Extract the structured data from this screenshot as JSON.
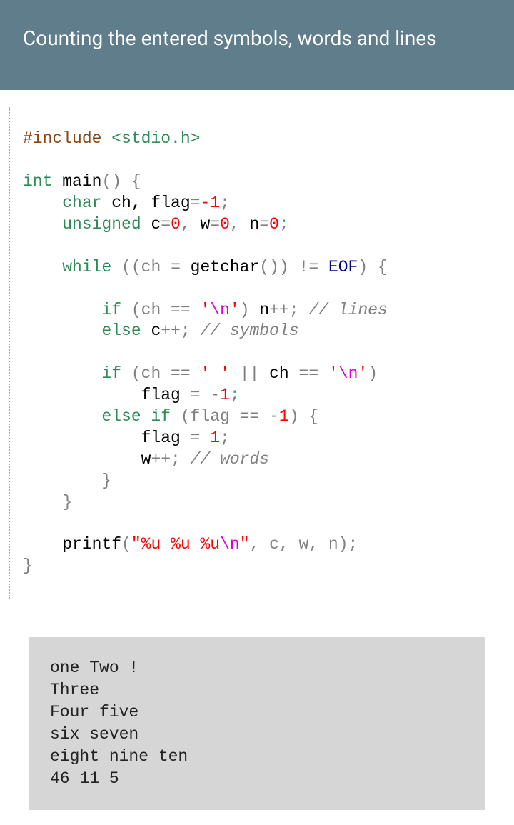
{
  "header": {
    "title": "Counting the entered symbols, words and lines"
  },
  "code": {
    "l1_include": "#include",
    "l1_hdr_open": " <",
    "l1_hdr": "stdio.h",
    "l1_hdr_close": ">",
    "l3_int": "int",
    "l3_main": " main",
    "l3_parens": "() {",
    "l4_char": "    char",
    "l4_vars": " ch, flag",
    "l4_eq": "=",
    "l4_neg1": "-1",
    "l4_semi": ";",
    "l5_unsigned": "    unsigned",
    "l5_c": " c",
    "l5_eq1": "=",
    "l5_z1": "0",
    "l5_c1": ", ",
    "l5_w": "w",
    "l5_eq2": "=",
    "l5_z2": "0",
    "l5_c2": ", ",
    "l5_n": "n",
    "l5_eq3": "=",
    "l5_z3": "0",
    "l5_semi": ";",
    "l7_while": "    while",
    "l7_open": " ((ch ",
    "l7_eq": "= ",
    "l7_getchar": "getchar",
    "l7_mid": "()) ",
    "l7_neq": "!= ",
    "l7_eof": "EOF",
    "l7_close": ") {",
    "l9_if": "        if",
    "l9_open": " (ch ",
    "l9_eqeq": "== ",
    "l9_q1": "'",
    "l9_esc": "\\n",
    "l9_q2": "'",
    "l9_close": ") ",
    "l9_npp": "n",
    "l9_pp": "++; ",
    "l9_cmt": "// lines",
    "l10_else": "        else",
    "l10_cpp": " c",
    "l10_pp": "++; ",
    "l10_cmt": "// symbols",
    "l12_if": "        if",
    "l12_open": " (ch ",
    "l12_eqeq1": "== ",
    "l12_sp": "' '",
    "l12_or": " || ",
    "l12_ch2": "ch ",
    "l12_eqeq2": "== ",
    "l12_q1": "'",
    "l12_esc": "\\n",
    "l12_q2": "'",
    "l12_close": ")",
    "l13_flag": "            flag ",
    "l13_eq": "= ",
    "l13_neg": "-",
    "l13_1": "1",
    "l13_semi": ";",
    "l14_else": "        else if",
    "l14_open": " (flag ",
    "l14_eqeq": "== ",
    "l14_neg": "-",
    "l14_1": "1",
    "l14_close": ") {",
    "l15_flag": "            flag ",
    "l15_eq": "= ",
    "l15_1": "1",
    "l15_semi": ";",
    "l16_wpp": "            w",
    "l16_pp": "++; ",
    "l16_cmt": "// words",
    "l17_close": "        }",
    "l18_close": "    }",
    "l20_printf": "    printf",
    "l20_open": "(",
    "l20_q1": "\"",
    "l20_s1": "%u %u %u",
    "l20_esc": "\\n",
    "l20_q2": "\"",
    "l20_args": ", c, w, n);",
    "l21_close": "}"
  },
  "output": {
    "l1": "one Two !",
    "l2": "Three",
    "l3": "Four five",
    "l4": "six seven",
    "l5": "eight nine ten",
    "l6": "46 11 5"
  }
}
